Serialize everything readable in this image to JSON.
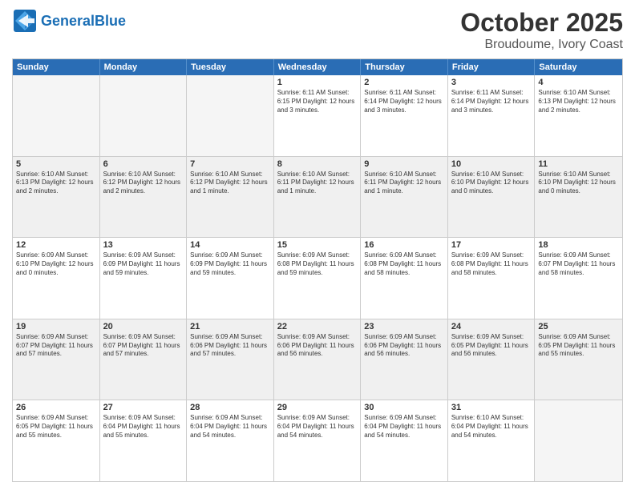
{
  "header": {
    "logo_general": "General",
    "logo_blue": "Blue",
    "month": "October 2025",
    "location": "Broudoume, Ivory Coast"
  },
  "days_of_week": [
    "Sunday",
    "Monday",
    "Tuesday",
    "Wednesday",
    "Thursday",
    "Friday",
    "Saturday"
  ],
  "weeks": [
    [
      {
        "day": "",
        "empty": true
      },
      {
        "day": "",
        "empty": true
      },
      {
        "day": "",
        "empty": true
      },
      {
        "day": "1",
        "info": "Sunrise: 6:11 AM\nSunset: 6:15 PM\nDaylight: 12 hours\nand 3 minutes."
      },
      {
        "day": "2",
        "info": "Sunrise: 6:11 AM\nSunset: 6:14 PM\nDaylight: 12 hours\nand 3 minutes."
      },
      {
        "day": "3",
        "info": "Sunrise: 6:11 AM\nSunset: 6:14 PM\nDaylight: 12 hours\nand 3 minutes."
      },
      {
        "day": "4",
        "info": "Sunrise: 6:10 AM\nSunset: 6:13 PM\nDaylight: 12 hours\nand 2 minutes."
      }
    ],
    [
      {
        "day": "5",
        "info": "Sunrise: 6:10 AM\nSunset: 6:13 PM\nDaylight: 12 hours\nand 2 minutes."
      },
      {
        "day": "6",
        "info": "Sunrise: 6:10 AM\nSunset: 6:12 PM\nDaylight: 12 hours\nand 2 minutes."
      },
      {
        "day": "7",
        "info": "Sunrise: 6:10 AM\nSunset: 6:12 PM\nDaylight: 12 hours\nand 1 minute."
      },
      {
        "day": "8",
        "info": "Sunrise: 6:10 AM\nSunset: 6:11 PM\nDaylight: 12 hours\nand 1 minute."
      },
      {
        "day": "9",
        "info": "Sunrise: 6:10 AM\nSunset: 6:11 PM\nDaylight: 12 hours\nand 1 minute."
      },
      {
        "day": "10",
        "info": "Sunrise: 6:10 AM\nSunset: 6:10 PM\nDaylight: 12 hours\nand 0 minutes."
      },
      {
        "day": "11",
        "info": "Sunrise: 6:10 AM\nSunset: 6:10 PM\nDaylight: 12 hours\nand 0 minutes."
      }
    ],
    [
      {
        "day": "12",
        "info": "Sunrise: 6:09 AM\nSunset: 6:10 PM\nDaylight: 12 hours\nand 0 minutes."
      },
      {
        "day": "13",
        "info": "Sunrise: 6:09 AM\nSunset: 6:09 PM\nDaylight: 11 hours\nand 59 minutes."
      },
      {
        "day": "14",
        "info": "Sunrise: 6:09 AM\nSunset: 6:09 PM\nDaylight: 11 hours\nand 59 minutes."
      },
      {
        "day": "15",
        "info": "Sunrise: 6:09 AM\nSunset: 6:08 PM\nDaylight: 11 hours\nand 59 minutes."
      },
      {
        "day": "16",
        "info": "Sunrise: 6:09 AM\nSunset: 6:08 PM\nDaylight: 11 hours\nand 58 minutes."
      },
      {
        "day": "17",
        "info": "Sunrise: 6:09 AM\nSunset: 6:08 PM\nDaylight: 11 hours\nand 58 minutes."
      },
      {
        "day": "18",
        "info": "Sunrise: 6:09 AM\nSunset: 6:07 PM\nDaylight: 11 hours\nand 58 minutes."
      }
    ],
    [
      {
        "day": "19",
        "info": "Sunrise: 6:09 AM\nSunset: 6:07 PM\nDaylight: 11 hours\nand 57 minutes."
      },
      {
        "day": "20",
        "info": "Sunrise: 6:09 AM\nSunset: 6:07 PM\nDaylight: 11 hours\nand 57 minutes."
      },
      {
        "day": "21",
        "info": "Sunrise: 6:09 AM\nSunset: 6:06 PM\nDaylight: 11 hours\nand 57 minutes."
      },
      {
        "day": "22",
        "info": "Sunrise: 6:09 AM\nSunset: 6:06 PM\nDaylight: 11 hours\nand 56 minutes."
      },
      {
        "day": "23",
        "info": "Sunrise: 6:09 AM\nSunset: 6:06 PM\nDaylight: 11 hours\nand 56 minutes."
      },
      {
        "day": "24",
        "info": "Sunrise: 6:09 AM\nSunset: 6:05 PM\nDaylight: 11 hours\nand 56 minutes."
      },
      {
        "day": "25",
        "info": "Sunrise: 6:09 AM\nSunset: 6:05 PM\nDaylight: 11 hours\nand 55 minutes."
      }
    ],
    [
      {
        "day": "26",
        "info": "Sunrise: 6:09 AM\nSunset: 6:05 PM\nDaylight: 11 hours\nand 55 minutes."
      },
      {
        "day": "27",
        "info": "Sunrise: 6:09 AM\nSunset: 6:04 PM\nDaylight: 11 hours\nand 55 minutes."
      },
      {
        "day": "28",
        "info": "Sunrise: 6:09 AM\nSunset: 6:04 PM\nDaylight: 11 hours\nand 54 minutes."
      },
      {
        "day": "29",
        "info": "Sunrise: 6:09 AM\nSunset: 6:04 PM\nDaylight: 11 hours\nand 54 minutes."
      },
      {
        "day": "30",
        "info": "Sunrise: 6:09 AM\nSunset: 6:04 PM\nDaylight: 11 hours\nand 54 minutes."
      },
      {
        "day": "31",
        "info": "Sunrise: 6:10 AM\nSunset: 6:04 PM\nDaylight: 11 hours\nand 54 minutes."
      },
      {
        "day": "",
        "empty": true
      }
    ]
  ]
}
